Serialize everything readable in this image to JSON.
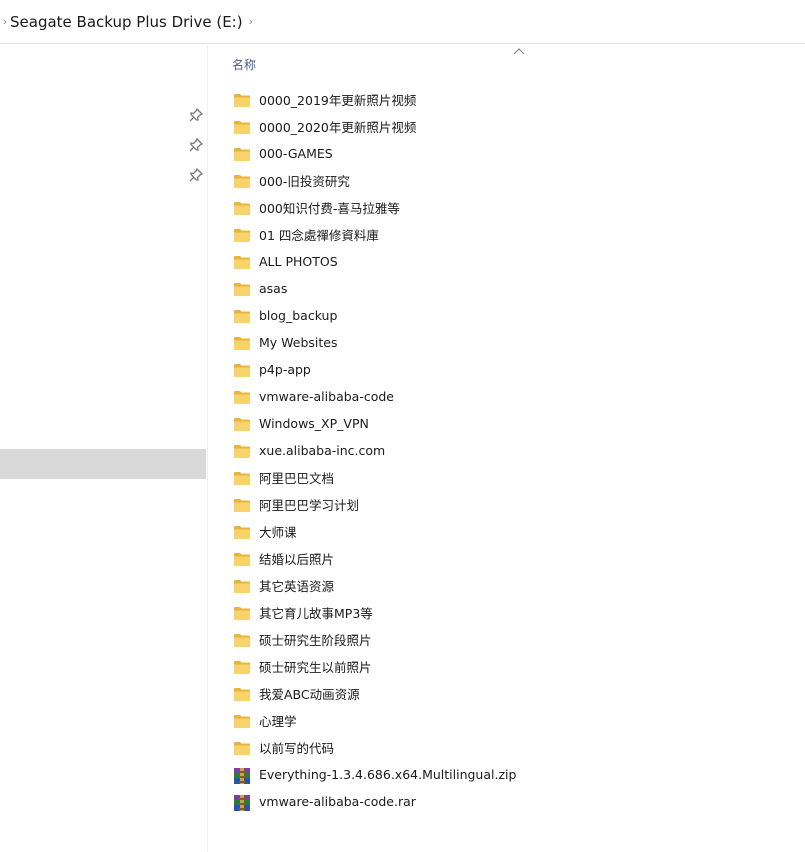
{
  "address": {
    "location": "Seagate Backup Plus Drive (E:)",
    "chevron_left": "›",
    "chevron_right": "›"
  },
  "header": {
    "name_column": "名称",
    "sort_glyph": "^"
  },
  "nav": {
    "pins": [
      "pin-icon",
      "pin-icon",
      "pin-icon"
    ]
  },
  "files": [
    {
      "name": "0000_2019年更新照片视频",
      "type": "folder"
    },
    {
      "name": "0000_2020年更新照片视频",
      "type": "folder"
    },
    {
      "name": "000-GAMES",
      "type": "folder"
    },
    {
      "name": "000-旧投资研究",
      "type": "folder"
    },
    {
      "name": "000知识付费-喜马拉雅等",
      "type": "folder"
    },
    {
      "name": "01 四念處禪修資料庫",
      "type": "folder"
    },
    {
      "name": "ALL PHOTOS",
      "type": "folder"
    },
    {
      "name": "asas",
      "type": "folder"
    },
    {
      "name": "blog_backup",
      "type": "folder"
    },
    {
      "name": "My Websites",
      "type": "folder"
    },
    {
      "name": "p4p-app",
      "type": "folder"
    },
    {
      "name": "vmware-alibaba-code",
      "type": "folder"
    },
    {
      "name": "Windows_XP_VPN",
      "type": "folder"
    },
    {
      "name": "xue.alibaba-inc.com",
      "type": "folder"
    },
    {
      "name": "阿里巴巴文档",
      "type": "folder"
    },
    {
      "name": "阿里巴巴学习计划",
      "type": "folder"
    },
    {
      "name": "大师课",
      "type": "folder"
    },
    {
      "name": "结婚以后照片",
      "type": "folder"
    },
    {
      "name": "其它英语资源",
      "type": "folder"
    },
    {
      "name": "其它育儿故事MP3等",
      "type": "folder"
    },
    {
      "name": "硕士研究生阶段照片",
      "type": "folder"
    },
    {
      "name": "硕士研究生以前照片",
      "type": "folder"
    },
    {
      "name": "我爱ABC动画资源",
      "type": "folder"
    },
    {
      "name": "心理学",
      "type": "folder"
    },
    {
      "name": "以前写的代码",
      "type": "folder"
    },
    {
      "name": "Everything-1.3.4.686.x64.Multilingual.zip",
      "type": "archive"
    },
    {
      "name": "vmware-alibaba-code.rar",
      "type": "archive"
    }
  ],
  "colors": {
    "folder": "#f8d26a",
    "folder_dark": "#e8b43c",
    "selected": "#d9d9d9",
    "header_text": "#4c607a"
  }
}
